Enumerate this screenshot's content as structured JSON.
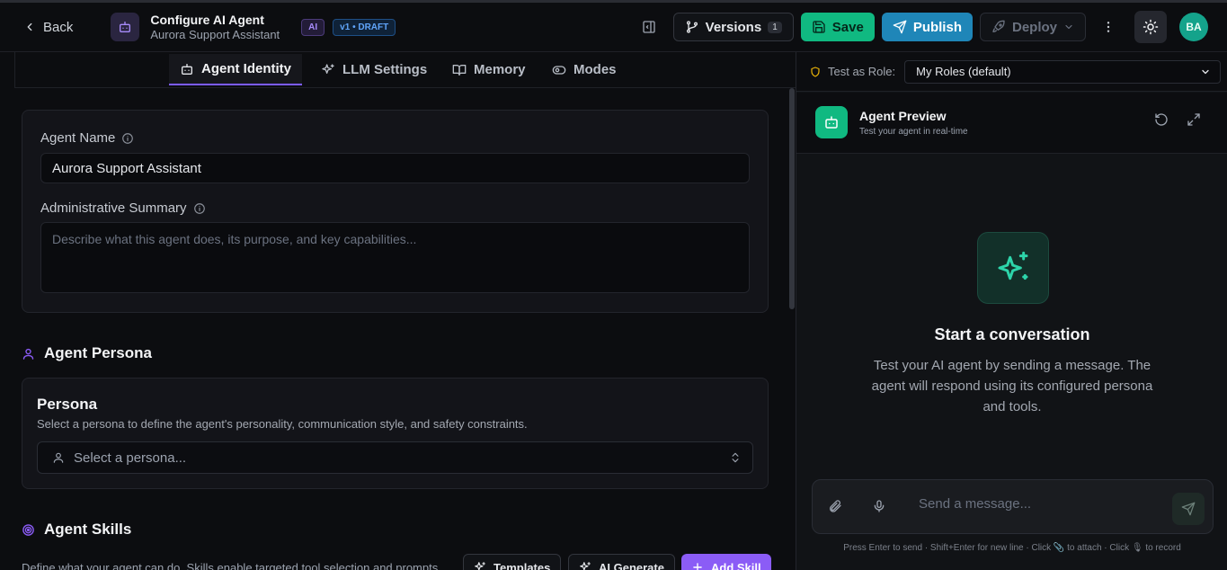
{
  "header": {
    "back_label": "Back",
    "title": "Configure AI Agent",
    "subtitle": "Aurora Support Assistant",
    "badge_ai": "AI",
    "badge_version": "v1 • DRAFT",
    "versions_label": "Versions",
    "versions_count": "1",
    "save_label": "Save",
    "publish_label": "Publish",
    "deploy_label": "Deploy",
    "avatar_initials": "BA"
  },
  "tabs": [
    {
      "label": "Agent Identity",
      "icon": "bot-icon",
      "active": true
    },
    {
      "label": "LLM Settings",
      "icon": "sparkles-icon",
      "active": false
    },
    {
      "label": "Memory",
      "icon": "book-icon",
      "active": false
    },
    {
      "label": "Modes",
      "icon": "toggle-icon",
      "active": false
    }
  ],
  "identity": {
    "name_label": "Agent Name",
    "name_value": "Aurora Support Assistant",
    "summary_label": "Administrative Summary",
    "summary_placeholder": "Describe what this agent does, its purpose, and key capabilities..."
  },
  "persona": {
    "section_title": "Agent Persona",
    "card_title": "Persona",
    "card_desc": "Select a persona to define the agent's personality, communication style, and safety constraints.",
    "select_placeholder": "Select a persona..."
  },
  "skills": {
    "section_title": "Agent Skills",
    "desc": "Define what your agent can do. Skills enable targeted tool selection and prompts",
    "templates_label": "Templates",
    "ai_generate_label": "AI Generate",
    "add_skill_label": "Add Skill"
  },
  "preview": {
    "role_label": "Test as Role:",
    "role_value": "My Roles (default)",
    "title": "Agent Preview",
    "subtitle": "Test your agent in real-time",
    "empty_title": "Start a conversation",
    "empty_desc": "Test your AI agent by sending a message. The agent will respond using its configured persona and tools.",
    "input_placeholder": "Send a message...",
    "hint": "Press Enter to send · Shift+Enter for new line · Click 📎 to attach · Click 🎙 to record"
  },
  "colors": {
    "accent_purple": "#8b5cf6",
    "save_green": "#10b981",
    "publish_blue": "#1f86b8",
    "background": "#0c0d10"
  }
}
